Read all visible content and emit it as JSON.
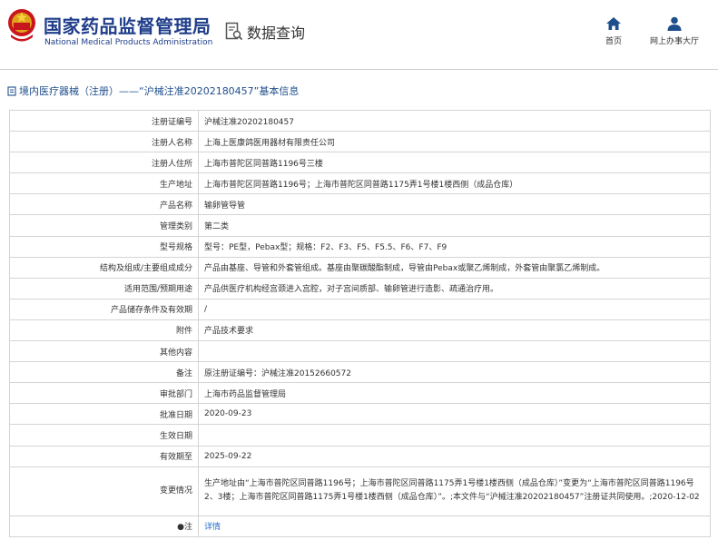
{
  "header": {
    "brand_cn": "国家药品监督管理局",
    "brand_en": "National Medical Products Administration",
    "query_label": "数据查询",
    "nav": [
      {
        "label": "首页",
        "icon": "home-icon"
      },
      {
        "label": "网上办事大厅",
        "icon": "user-icon"
      }
    ]
  },
  "breadcrumb": "境内医疗器械（注册）——“沪械注准20202180457”基本信息",
  "rows": [
    {
      "key": "注册证编号",
      "value": "沪械注准20202180457"
    },
    {
      "key": "注册人名称",
      "value": "上海上医康鸽医用器材有限责任公司"
    },
    {
      "key": "注册人住所",
      "value": "上海市普陀区同普路1196号三楼"
    },
    {
      "key": "生产地址",
      "value": "上海市普陀区同普路1196号；上海市普陀区同普路1175弄1号楼1楼西侧（成品仓库）"
    },
    {
      "key": "产品名称",
      "value": "输卵管导管"
    },
    {
      "key": "管理类别",
      "value": "第二类"
    },
    {
      "key": "型号规格",
      "value": "型号：PE型，Pebax型；规格：F2、F3、F5、F5.5、F6、F7、F9"
    },
    {
      "key": "结构及组成/主要组成成分",
      "value": "产品由基座、导管和外套管组成。基座由聚碳酸酯制成，导管由Pebax或聚乙烯制成，外套管由聚氯乙烯制成。"
    },
    {
      "key": "适用范围/预期用途",
      "value": "产品供医疗机构经宫颈进入宫腔，对子宫间质部、输卵管进行造影、疏通治疗用。"
    },
    {
      "key": "产品储存条件及有效期",
      "value": "/"
    },
    {
      "key": "附件",
      "value": "产品技术要求"
    },
    {
      "key": "其他内容",
      "value": ""
    },
    {
      "key": "备注",
      "value": "原注册证编号：沪械注准20152660572"
    },
    {
      "key": "审批部门",
      "value": "上海市药品监督管理局"
    },
    {
      "key": "批准日期",
      "value": "2020-09-23"
    },
    {
      "key": "生效日期",
      "value": ""
    },
    {
      "key": "有效期至",
      "value": "2025-09-22"
    },
    {
      "key": "变更情况",
      "value": "生产地址由“上海市普陀区同普路1196号；上海市普陀区同普路1175弄1号楼1楼西侧（成品仓库）”变更为“上海市普陀区同普路1196号2、3楼；上海市普陀区同普路1175弄1号楼1楼西侧（成品仓库）”。;本文件与“沪械注准20202180457”注册证共同使用。;2020-12-02"
    },
    {
      "key": "注",
      "value": "详情"
    }
  ],
  "colors": {
    "brand": "#1f3d8a",
    "link": "#1f6fc8",
    "border": "#d4d4d4"
  }
}
